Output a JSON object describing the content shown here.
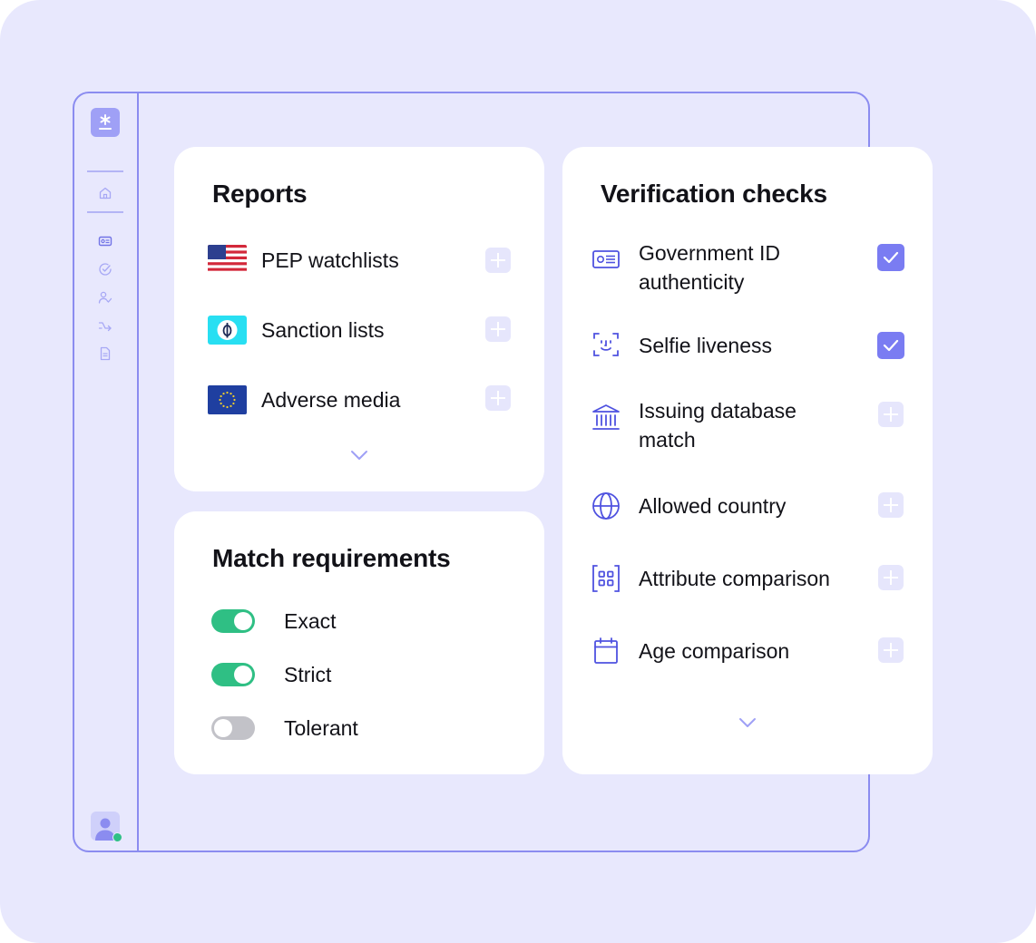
{
  "colors": {
    "background": "#e8e8fd",
    "accent": "#7a7cf2",
    "toggle_on": "#2fbf84",
    "toggle_off": "#c2c2c8"
  },
  "sidebar": {
    "logo_icon": "asterisk-logo-icon",
    "items": [
      {
        "icon": "home-icon"
      },
      {
        "icon": "id-card-icon"
      },
      {
        "icon": "check-circle-icon"
      },
      {
        "icon": "user-check-icon"
      },
      {
        "icon": "workflow-icon"
      },
      {
        "icon": "document-icon"
      }
    ],
    "avatar_icon": "user-avatar-icon",
    "status": "online"
  },
  "reports": {
    "title": "Reports",
    "items": [
      {
        "label": "PEP watchlists",
        "icon": "us-flag-icon",
        "added": false
      },
      {
        "label": "Sanction lists",
        "icon": "sanctions-icon",
        "added": false
      },
      {
        "label": "Adverse media",
        "icon": "eu-flag-icon",
        "added": false
      }
    ],
    "more_icon": "chevron-down-icon"
  },
  "match": {
    "title": "Match requirements",
    "items": [
      {
        "label": "Exact",
        "on": true
      },
      {
        "label": "Strict",
        "on": true
      },
      {
        "label": "Tolerant",
        "on": false
      }
    ]
  },
  "verification": {
    "title": "Verification checks",
    "items": [
      {
        "line1": "Government ID",
        "line2": "authenticity",
        "icon": "id-card-icon",
        "checked": true
      },
      {
        "line1": "Selfie liveness",
        "line2": "",
        "icon": "face-scan-icon",
        "checked": true
      },
      {
        "line1": "Issuing database",
        "line2": "match",
        "icon": "bank-icon",
        "checked": false
      },
      {
        "line1": "Allowed country",
        "line2": "",
        "icon": "globe-icon",
        "checked": false
      },
      {
        "line1": "Attribute comparison",
        "line2": "",
        "icon": "grid-scan-icon",
        "checked": false
      },
      {
        "line1": "Age comparison",
        "line2": "",
        "icon": "calendar-icon",
        "checked": false
      }
    ],
    "more_icon": "chevron-down-icon"
  }
}
